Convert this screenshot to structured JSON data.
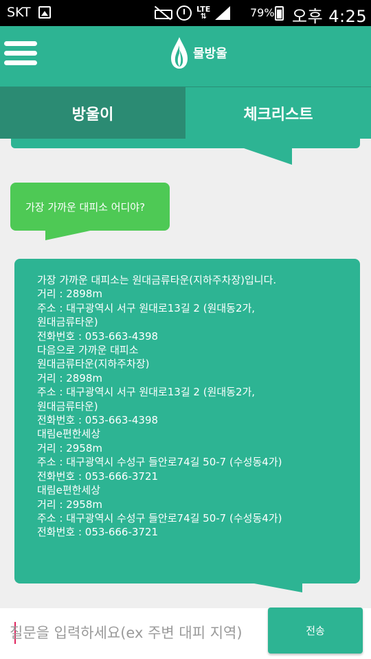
{
  "status_bar": {
    "carrier": "SKT",
    "network": "LTE",
    "battery": "79%",
    "clock": "오후 4:25",
    "icons": [
      "image-icon",
      "mute-icon",
      "alarm-icon",
      "signal-icon",
      "battery-icon"
    ]
  },
  "app_bar": {
    "logo_text": "물방울",
    "menu_icon": "hamburger-menu-icon",
    "logo_icon": "water-drop-icon"
  },
  "tabs": [
    {
      "label": "방울이",
      "active": true
    },
    {
      "label": "체크리스트",
      "active": false
    }
  ],
  "messages": {
    "user": "가장 가까운 대피소 어디야?",
    "bot": [
      "가장 가까운 대피소는 원대금류타운(지하주차장)입니다.",
      "거리 : 2898m",
      "주소 : 대구광역시 서구 원대로13길 2 (원대동2가,",
      "원대금류타운)",
      "전화번호 : 053-663-4398",
      "다음으로 가까운 대피소",
      "원대금류타운(지하주차장)",
      "거리 : 2898m",
      "주소 : 대구광역시 서구 원대로13길 2 (원대동2가,",
      "원대금류타운)",
      "전화번호 : 053-663-4398",
      "대림e편한세상",
      "거리 : 2958m",
      "주소 : 대구광역시 수성구 들안로74길 50-7 (수성동4가)",
      "전화번호 : 053-666-3721",
      "대림e편한세상",
      "거리 : 2958m",
      "주소 : 대구광역시 수성구 들안로74길 50-7 (수성동4가)",
      "전화번호 : 053-666-3721"
    ]
  },
  "input": {
    "placeholder": "질문을 입력하세요(ex 주변 대피 지역)",
    "value": "",
    "send_label": "전송"
  },
  "colors": {
    "primary": "#2db493",
    "primary_dark": "#2b8b73",
    "user_bubble": "#4ec955",
    "chat_background": "#efefef"
  }
}
